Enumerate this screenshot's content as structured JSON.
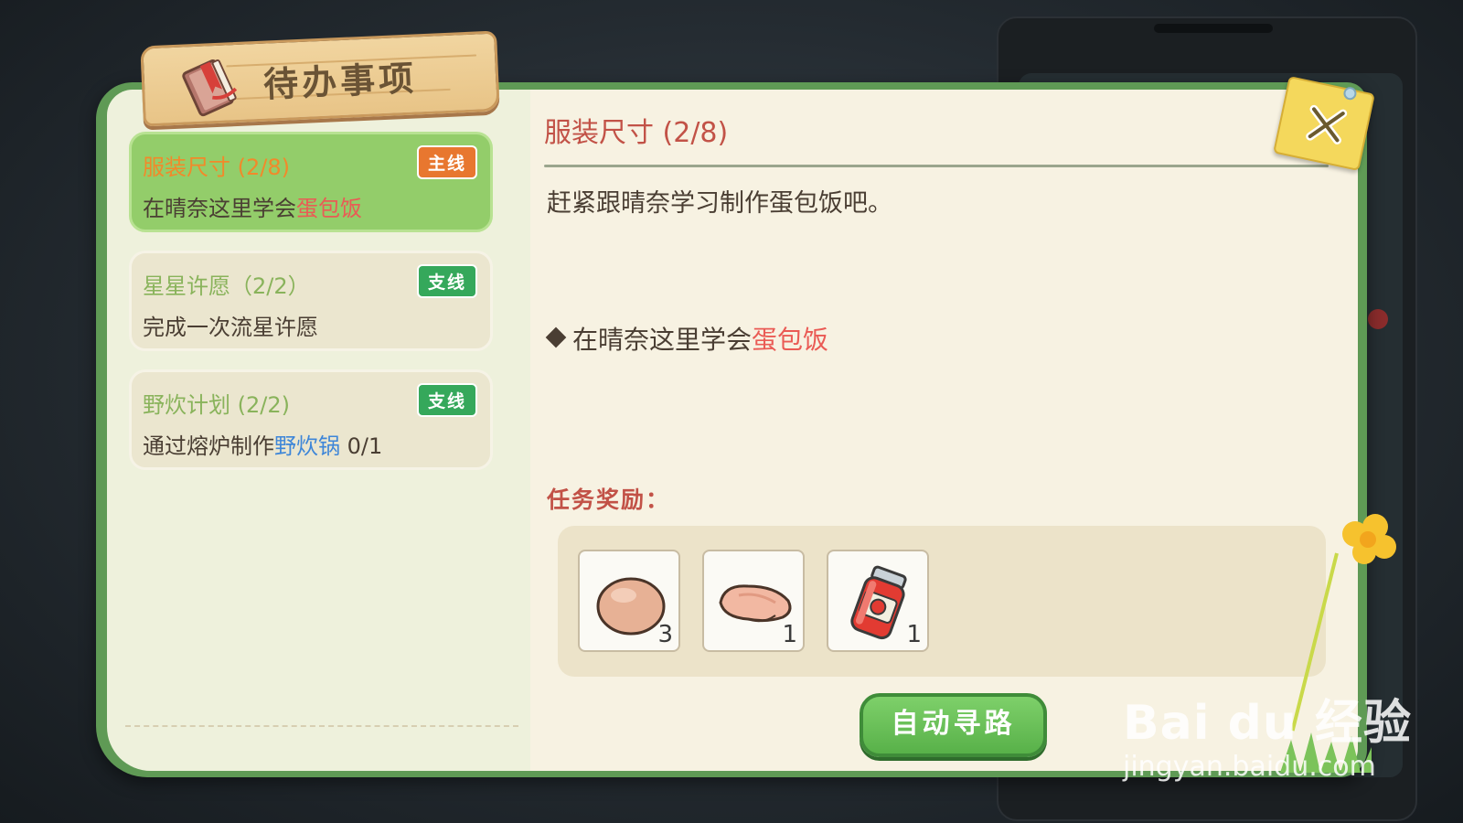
{
  "header": {
    "title": "待办事项"
  },
  "quests": [
    {
      "title": "服装尺寸 (2/8)",
      "badge": "主线",
      "desc_prefix": "在晴奈这里学会",
      "desc_highlight": "蛋包饭",
      "desc_suffix": "",
      "active": true
    },
    {
      "title": "星星许愿（2/2）",
      "badge": "支线",
      "desc_prefix": "完成一次流星许愿",
      "desc_highlight": "",
      "desc_suffix": "",
      "active": false
    },
    {
      "title": "野炊计划 (2/2)",
      "badge": "支线",
      "desc_prefix": "通过熔炉制作",
      "desc_highlight": "野炊锅",
      "desc_suffix": " 0/1",
      "active": false
    }
  ],
  "detail": {
    "title": "服装尺寸 (2/8)",
    "description": "赶紧跟晴奈学习制作蛋包饭吧。",
    "objective_prefix": "在晴奈这里学会",
    "objective_highlight": "蛋包饭",
    "reward_label": "任务奖励：",
    "rewards": [
      {
        "icon": "egg-icon",
        "count": "3"
      },
      {
        "icon": "chicken-breast-icon",
        "count": "1"
      },
      {
        "icon": "ketchup-jar-icon",
        "count": "1"
      }
    ]
  },
  "actions": {
    "auto_path": "自动寻路"
  },
  "watermark": {
    "brand": "Bai du 经验",
    "url": "jingyan.baidu.com"
  },
  "colors": {
    "board_green": "#5f9a55",
    "active_card": "#93cd6a",
    "main_badge": "#e8772f",
    "side_badge": "#35a85b",
    "highlight_red": "#ea5b55",
    "highlight_blue": "#3e86d8",
    "title_red": "#c25247"
  }
}
